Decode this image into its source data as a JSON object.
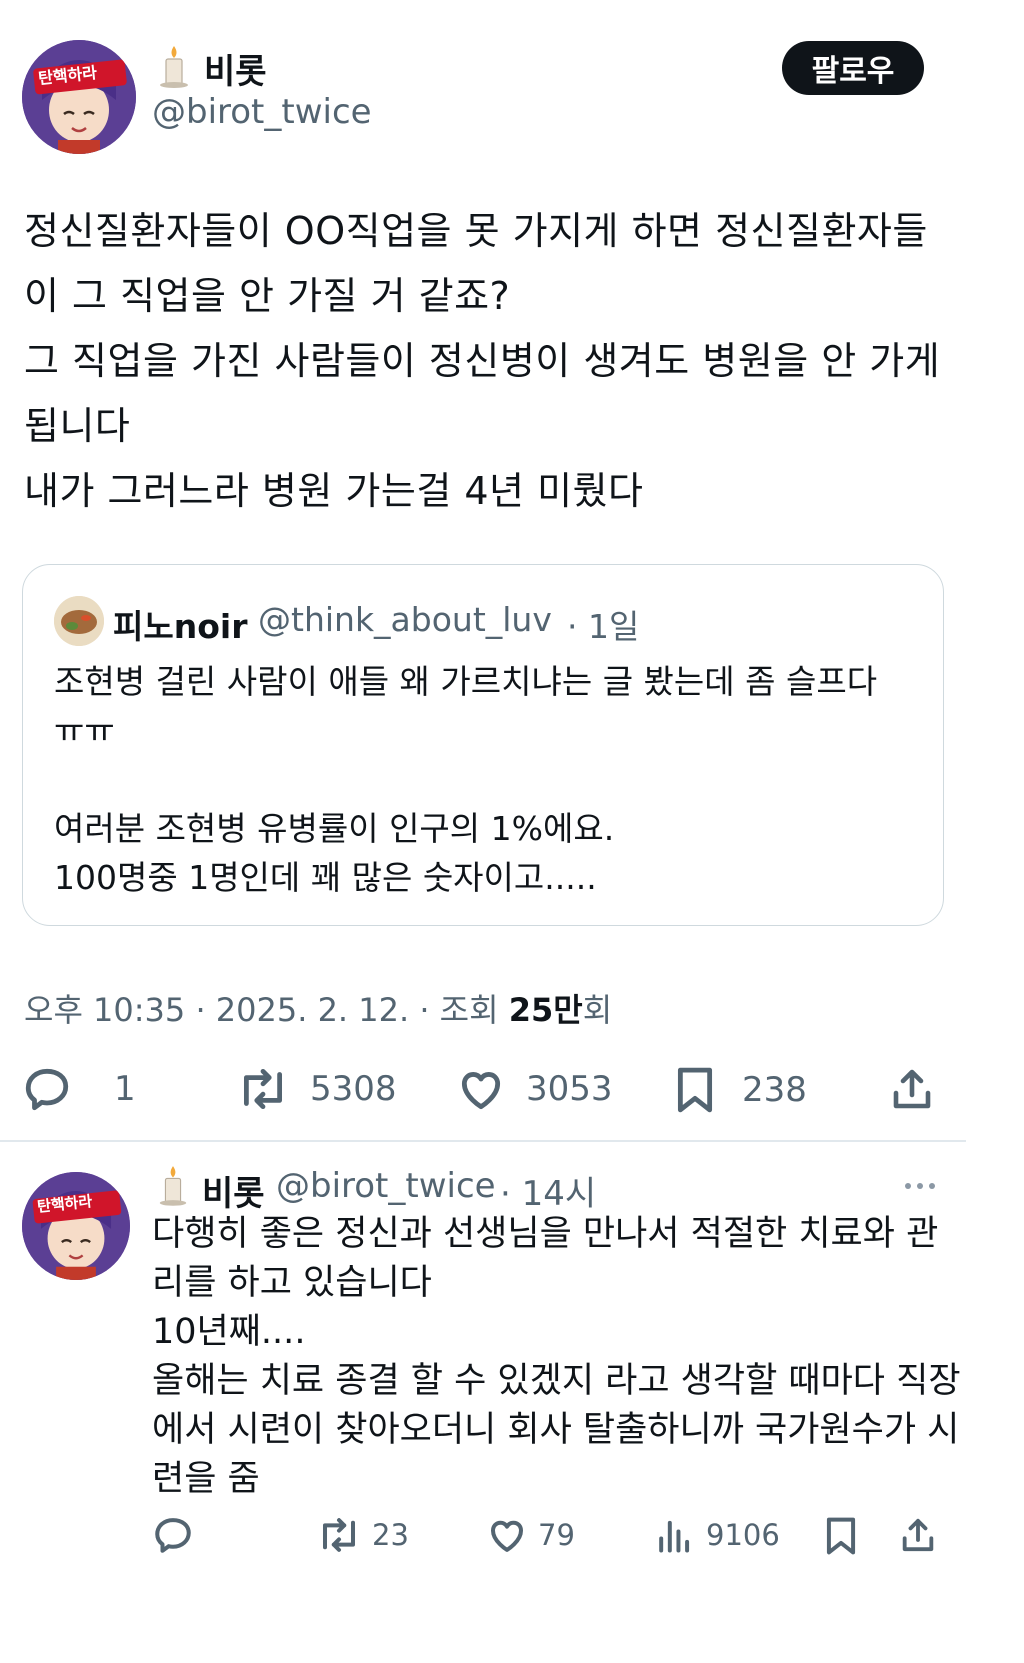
{
  "main_tweet": {
    "author_name": "비롯",
    "author_handle": "@birot_twice",
    "avatar_badge": "탄핵하라",
    "follow_label": "팔로우",
    "text": "정신질환자들이 OO직업을 못 가지게 하면 정신질환자들\n이 그 직업을 안 가질 거 같죠?\n그 직업을 가진 사람들이 정신병이 생겨도 병원을 안 가게\n됩니다\n내가 그러느라 병원 가는걸 4년 미뤘다",
    "quote": {
      "author_name": "피노noir",
      "author_handle": "@think_about_luv",
      "time": "· 1일",
      "text": "조현병 걸린 사람이 애들 왜 가르치냐는 글 봤는데 좀 슬프다\nㅠㅠ\n\n여러분 조현병 유병률이 인구의 1%에요.\n100명중 1명인데 꽤 많은 숫자이고....."
    },
    "timestamp": "오후 10:35 · 2025. 2. 12. · 조회 ",
    "views_bold": "25만",
    "views_suffix": "회",
    "stats": {
      "replies": "1",
      "retweets": "5308",
      "likes": "3053",
      "bookmarks": "238"
    }
  },
  "reply_tweet": {
    "author_name": "비롯",
    "author_handle": "@birot_twice",
    "time": "· 14시",
    "avatar_badge": "탄핵하라",
    "text": "다행히 좋은 정신과 선생님을 만나서 적절한 치료와 관\n리를 하고 있습니다\n10년째....\n올해는 치료 종결 할 수 있겠지 라고 생각할 때마다 직장\n에서 시련이 찾아오더니 회사 탈출하니까 국가원수가 시\n련을 줌",
    "stats": {
      "replies": "",
      "retweets": "23",
      "likes": "79",
      "views": "9106"
    }
  },
  "colors": {
    "text_primary": "#0f1419",
    "text_secondary": "#536471",
    "border": "#cfd9de",
    "avatar_bg": "#6b4fa0",
    "badge_red": "#d0152a"
  }
}
